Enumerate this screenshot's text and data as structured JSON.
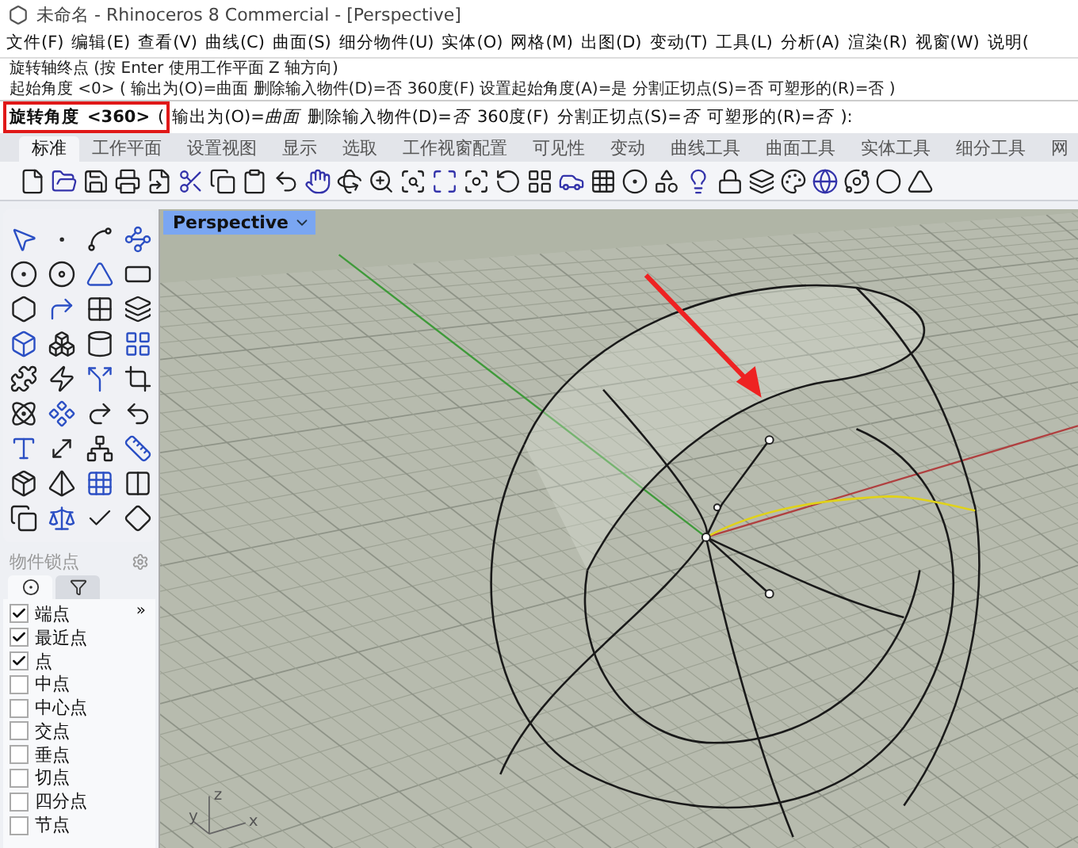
{
  "window": {
    "title": "未命名 - Rhinoceros 8 Commercial - [Perspective]"
  },
  "menu": [
    "文件(F)",
    "编辑(E)",
    "查看(V)",
    "曲线(C)",
    "曲面(S)",
    "细分物件(U)",
    "实体(O)",
    "网格(M)",
    "出图(D)",
    "变动(T)",
    "工具(L)",
    "分析(A)",
    "渲染(R)",
    "视窗(W)",
    "说明("
  ],
  "command_history": [
    "旋转轴终点 (按 Enter 使用工作平面 Z 轴方向)",
    "起始角度 <0> ( 输出为(O)=曲面  删除输入物件(D)=否  360度(F)  设置起始角度(A)=是  分割正切点(S)=否  可塑形的(R)=否 )"
  ],
  "command_prompt": {
    "label": "旋转角度",
    "default": "<360>",
    "open": "(",
    "close": "):",
    "options": [
      {
        "name": "输出为(O)=",
        "value": "曲面"
      },
      {
        "name": "删除输入物件(D)=",
        "value": "否"
      },
      {
        "name": "360度(F)"
      },
      {
        "name": "分割正切点(S)=",
        "value": "否"
      },
      {
        "name": "可塑形的(R)=",
        "value": "否"
      }
    ]
  },
  "toolbar_tabs": [
    {
      "label": "标准",
      "selected": true
    },
    {
      "label": "工作平面",
      "selected": false
    },
    {
      "label": "设置视图",
      "selected": false
    },
    {
      "label": "显示",
      "selected": false
    },
    {
      "label": "选取",
      "selected": false
    },
    {
      "label": "工作视窗配置",
      "selected": false
    },
    {
      "label": "可见性",
      "selected": false
    },
    {
      "label": "变动",
      "selected": false
    },
    {
      "label": "曲线工具",
      "selected": false
    },
    {
      "label": "曲面工具",
      "selected": false
    },
    {
      "label": "实体工具",
      "selected": false
    },
    {
      "label": "细分工具",
      "selected": false
    },
    {
      "label": "网",
      "selected": false
    }
  ],
  "osnap": {
    "title": "物件锁点",
    "tabs": [
      {
        "kind": "snap",
        "selected": true
      },
      {
        "kind": "filter",
        "selected": false
      }
    ],
    "more": "»",
    "items": [
      {
        "label": "端点",
        "checked": true
      },
      {
        "label": "最近点",
        "checked": true
      },
      {
        "label": "点",
        "checked": true
      },
      {
        "label": "中点",
        "checked": false
      },
      {
        "label": "中心点",
        "checked": false
      },
      {
        "label": "交点",
        "checked": false
      },
      {
        "label": "垂点",
        "checked": false
      },
      {
        "label": "切点",
        "checked": false
      },
      {
        "label": "四分点",
        "checked": false
      },
      {
        "label": "节点",
        "checked": false
      }
    ]
  },
  "viewport": {
    "name": "Perspective",
    "axis_labels": [
      "z",
      "y",
      "x"
    ]
  }
}
